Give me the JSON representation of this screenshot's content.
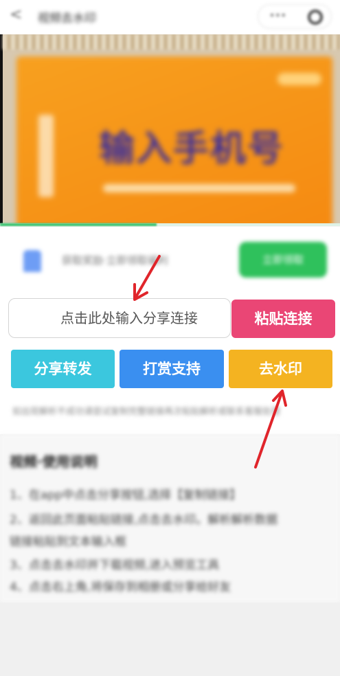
{
  "top_bar": {
    "back_glyph": "<",
    "title": "视频去水印",
    "menu_glyph": "•••"
  },
  "banner": {
    "headline": "输入手机号",
    "badge": "",
    "vertical_text": ""
  },
  "progress": {
    "value": 0.46
  },
  "info": {
    "text": "获取奖励·立即领取福利",
    "action_label": "立即领取"
  },
  "form": {
    "input_placeholder": "点击此处输入分享连接",
    "paste_label": "粘贴连接",
    "share_label": "分享转发",
    "reward_label": "打赏支持",
    "remove_watermark_label": "去水印",
    "note": "如出现解析不成功请尝试复制完整链接再次粘贴解析或联系客服处理"
  },
  "help": {
    "heading": "视频·使用说明",
    "lines": [
      "1、在app中点击分享按钮,选择【复制链接】",
      "2、返回此页面粘贴链接,点击去水印。解析解析数据",
      "   链接粘贴到文本输入框",
      "3、点击去水印并下载视频,进入预览工具",
      "4、点击右上角,将保存到相册或分享给好友"
    ]
  },
  "colors": {
    "paste": "#ea4675",
    "share": "#3bc7de",
    "reward": "#3a8ff0",
    "remove_watermark": "#f4b321",
    "annotation_arrow": "#e0252b",
    "banner": "#f5901a"
  }
}
